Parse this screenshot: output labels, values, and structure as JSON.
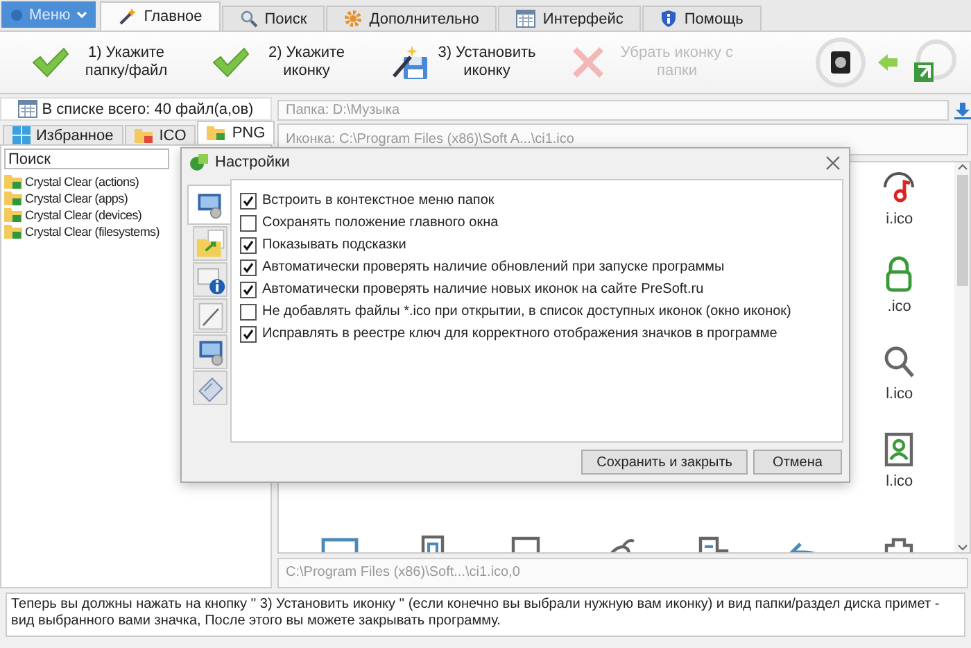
{
  "menu_button": {
    "label": "Меню"
  },
  "tabs": [
    {
      "label": "Главное",
      "selected": true
    },
    {
      "label": "Поиск",
      "selected": false
    },
    {
      "label": "Дополнительно",
      "selected": false
    },
    {
      "label": "Интерфейс",
      "selected": false
    },
    {
      "label": "Помощь",
      "selected": false
    }
  ],
  "ribbon": [
    {
      "label": "1)  Укажите папку/файл",
      "kind": "check",
      "disabled": false
    },
    {
      "label": "2)  Укажите иконку",
      "kind": "check",
      "disabled": false
    },
    {
      "label": "3)  Установить иконку",
      "kind": "install",
      "disabled": false
    },
    {
      "label": "Убрать иконку с папки",
      "kind": "remove",
      "disabled": true
    }
  ],
  "left_panel": {
    "count": "В списке всего: 40 файл(а,ов)",
    "tabs": [
      {
        "label": "Избранное",
        "selected": false
      },
      {
        "label": "ICO",
        "selected": false
      },
      {
        "label": "PNG",
        "selected": true
      }
    ],
    "search": {
      "value": "Поиск"
    },
    "tree": [
      {
        "label": "Crystal Clear (actions)"
      },
      {
        "label": "Crystal Clear (apps)"
      },
      {
        "label": "Crystal Clear (devices)"
      },
      {
        "label": "Crystal Clear (filesystems)"
      }
    ]
  },
  "right_panel": {
    "folder": "Папка: D:\\Музыка",
    "icon": "Иконка: C:\\Program Files (x86)\\Soft A...\\ci1.ico",
    "grid_labels": [
      "i.ico",
      ".ico",
      "l.ico",
      "l.ico"
    ],
    "path": "C:\\Program Files (x86)\\Soft...\\ci1.ico,0"
  },
  "hint": "Теперь вы должны нажать на кнопку '' 3)  Установить иконку '' (если конечно вы выбрали нужную вам иконку) и вид папки/раздел диска примет - вид выбранного вами значка, После этого вы можете закрывать программу.",
  "dialog": {
    "title": "Настройки",
    "side_tabs": [
      {
        "selected": true
      },
      {
        "selected": false
      },
      {
        "selected": false
      },
      {
        "selected": false
      },
      {
        "selected": false
      },
      {
        "selected": false
      }
    ],
    "options": [
      {
        "label": "Встроить в контекстное меню папок",
        "checked": true
      },
      {
        "label": "Сохранять положение главного окна",
        "checked": false
      },
      {
        "label": "Показывать подсказки",
        "checked": true
      },
      {
        "label": "Автоматически проверять наличие обновлений при запуске программы",
        "checked": true
      },
      {
        "label": "Автоматически проверять наличие новых иконок на сайте PreSoft.ru",
        "checked": true
      },
      {
        "label": "Не добавлять файлы *.ico при открытии, в список доступных иконок (окно иконок)",
        "checked": false
      },
      {
        "label": "Исправлять в реестре ключ для корректного отображения значков в программе",
        "checked": true
      }
    ],
    "buttons": [
      "Сохранить и закрыть",
      "Отмена"
    ]
  }
}
